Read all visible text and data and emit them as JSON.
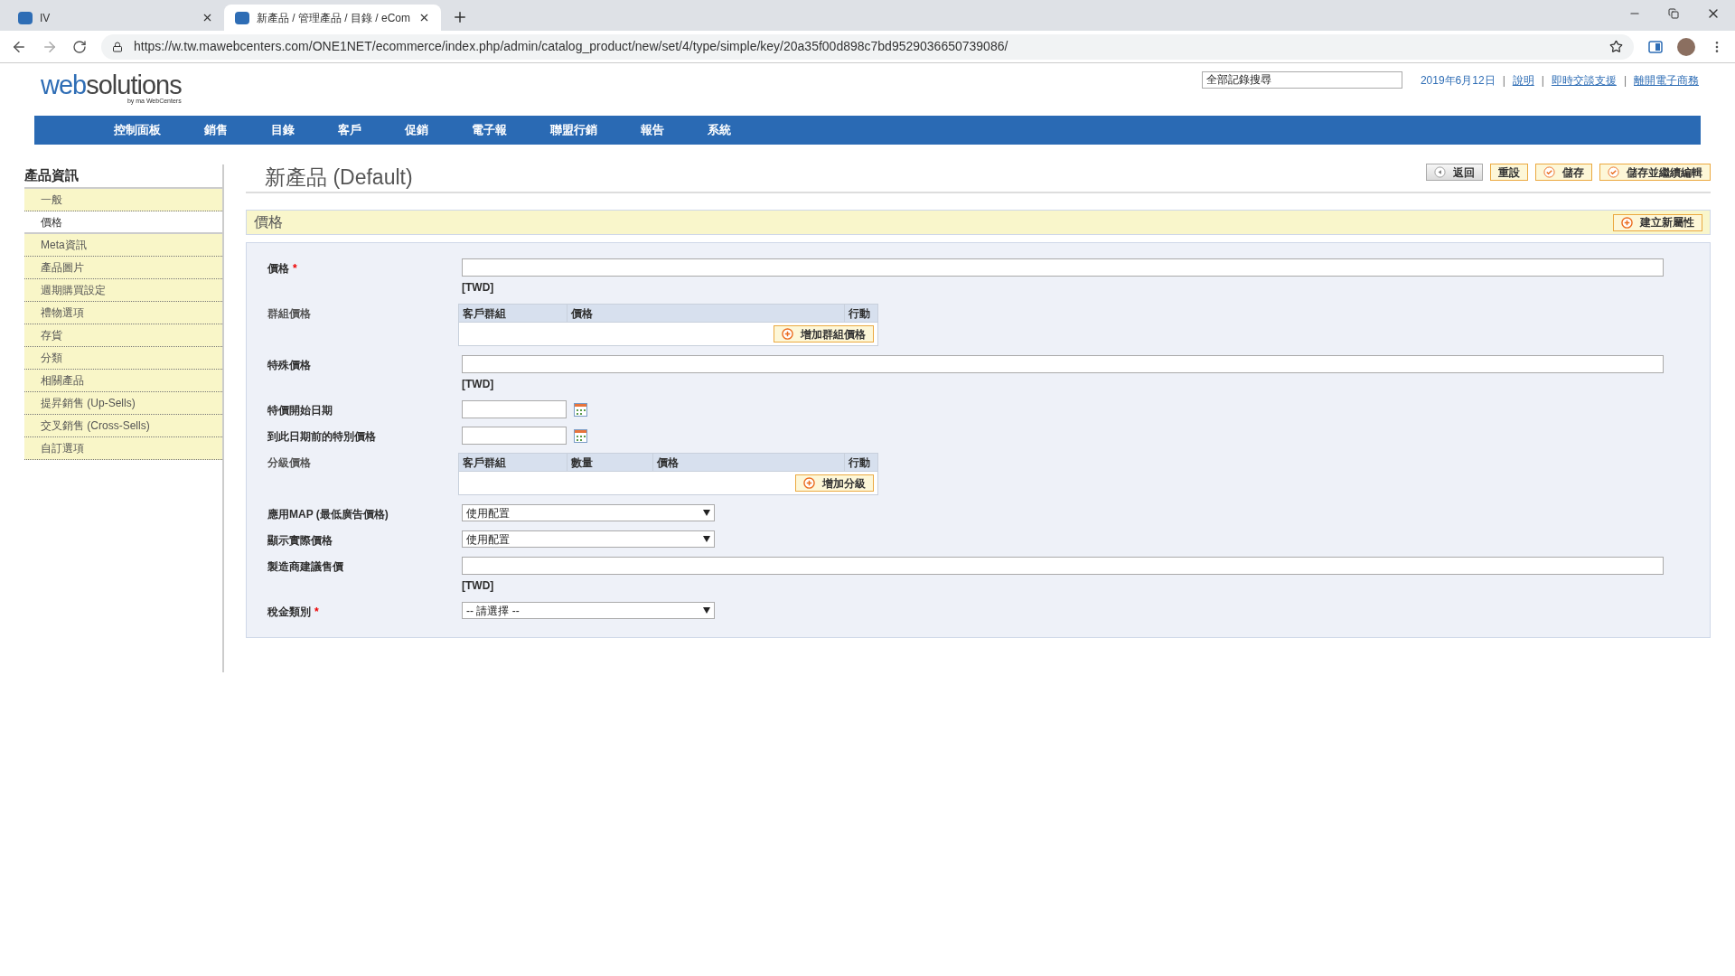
{
  "browser": {
    "tabs": [
      {
        "title": "IV",
        "selected": false
      },
      {
        "title": "新產品 / 管理產品 / 目錄 / eCom",
        "selected": true
      }
    ],
    "url": "https://w.tw.mawebcenters.com/ONE1NET/ecommerce/index.php/admin/catalog_product/new/set/4/type/simple/key/20a35f00d898c7bd9529036650739086/"
  },
  "header": {
    "logo": {
      "part1": "web",
      "part2": "solutions",
      "tagline": "by ma WebCenters"
    },
    "search": {
      "value": "全部記錄搜尋"
    },
    "date": "2019年6月12日",
    "links": [
      {
        "separator": "|",
        "label": "說明"
      },
      {
        "separator": "|",
        "label": "即時交談支援"
      },
      {
        "separator": "|",
        "label": "離開電子商務"
      }
    ]
  },
  "nav": [
    "控制面板",
    "銷售",
    "目錄",
    "客戶",
    "促銷",
    "電子報",
    "聯盟行銷",
    "報告",
    "系統"
  ],
  "sidebar": {
    "title": "產品資訊",
    "items": [
      {
        "label": "一般",
        "selected": false
      },
      {
        "label": "價格",
        "selected": true
      },
      {
        "label": "Meta資訊",
        "selected": false
      },
      {
        "label": "產品圖片",
        "selected": false
      },
      {
        "label": "週期購買設定",
        "selected": false
      },
      {
        "label": "禮物選項",
        "selected": false
      },
      {
        "label": "存貨",
        "selected": false
      },
      {
        "label": "分類",
        "selected": false
      },
      {
        "label": "相關產品",
        "selected": false
      },
      {
        "label": "提昇銷售 (Up-Sells)",
        "selected": false
      },
      {
        "label": "交叉銷售 (Cross-Sells)",
        "selected": false
      },
      {
        "label": "自訂選項",
        "selected": false
      }
    ]
  },
  "page": {
    "title": "新產品 (Default)",
    "buttons": [
      {
        "label": "返回",
        "kind": "back"
      },
      {
        "label": "重設",
        "kind": "plain"
      },
      {
        "label": "儲存",
        "kind": "save"
      },
      {
        "label": "儲存並繼續編輯",
        "kind": "save"
      }
    ]
  },
  "section": {
    "title": "價格",
    "button": "建立新屬性"
  },
  "fields": [
    {
      "kind": "text",
      "label": "價格",
      "required_mark": "*",
      "note": "[TWD]"
    },
    {
      "kind": "table",
      "label": "群組價格",
      "columns": [
        "客戶群組",
        "價格",
        "行動"
      ],
      "button": "增加群組價格"
    },
    {
      "kind": "text",
      "label": "特殊價格",
      "note": "[TWD]"
    },
    {
      "kind": "date",
      "label": "特價開始日期"
    },
    {
      "kind": "date",
      "label": "到此日期前的特別價格"
    },
    {
      "kind": "table",
      "label": "分級價格",
      "columns": [
        "客戶群組",
        "數量",
        "價格",
        "行動"
      ],
      "button": "增加分級"
    },
    {
      "kind": "select",
      "label": "應用MAP (最低廣告價格)",
      "value": "使用配置"
    },
    {
      "kind": "select",
      "label": "顯示實際價格",
      "value": "使用配置"
    },
    {
      "kind": "text",
      "label": "製造商建議售價",
      "note": "[TWD]"
    },
    {
      "kind": "select",
      "label": "稅金類別",
      "required_mark": "*",
      "value": "-- 請選擇 --"
    }
  ]
}
